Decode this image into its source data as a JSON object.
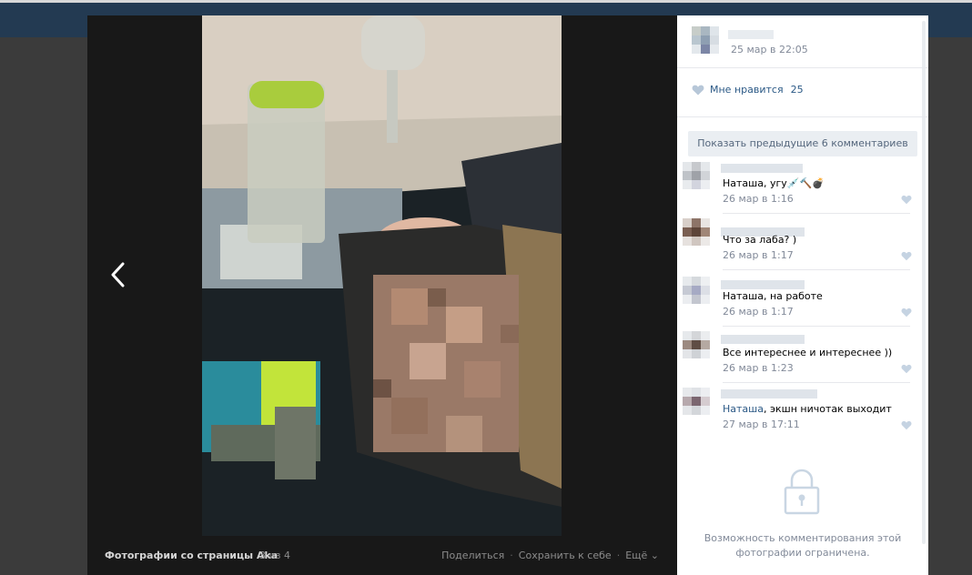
{
  "viewer": {
    "album_title": "Фотографии со страницы Aka",
    "counter": "3 из 4",
    "actions": [
      "Поделиться",
      "Сохранить к себе",
      "Ещё"
    ]
  },
  "post": {
    "date": "25 мар в 22:05",
    "like_label": "Мне нравится",
    "like_count": "25",
    "show_previous": "Показать предыдущие 6 комментариев"
  },
  "comments": [
    {
      "mention": "",
      "text": "Наташа, угу",
      "emoji": "💉🔨💣",
      "date": "26 мар в 1:16"
    },
    {
      "mention": "",
      "text": "Что за лаба? )",
      "emoji": "",
      "date": "26 мар в 1:17"
    },
    {
      "mention": "",
      "text": "Наташа, на работе",
      "emoji": "",
      "date": "26 мар в 1:17"
    },
    {
      "mention": "",
      "text": "Все интереснее и интереснее ))",
      "emoji": "",
      "date": "26 мар в 1:23"
    },
    {
      "mention": "Наташа",
      "text": ", экшн ничотак выходит",
      "emoji": "",
      "date": "27 мар в 17:11"
    }
  ],
  "restriction_text": "Возможность комментирования этой фотографии ограничена.",
  "colors": {
    "link": "#2a5885",
    "muted": "#828a99",
    "header": "#233a52"
  }
}
